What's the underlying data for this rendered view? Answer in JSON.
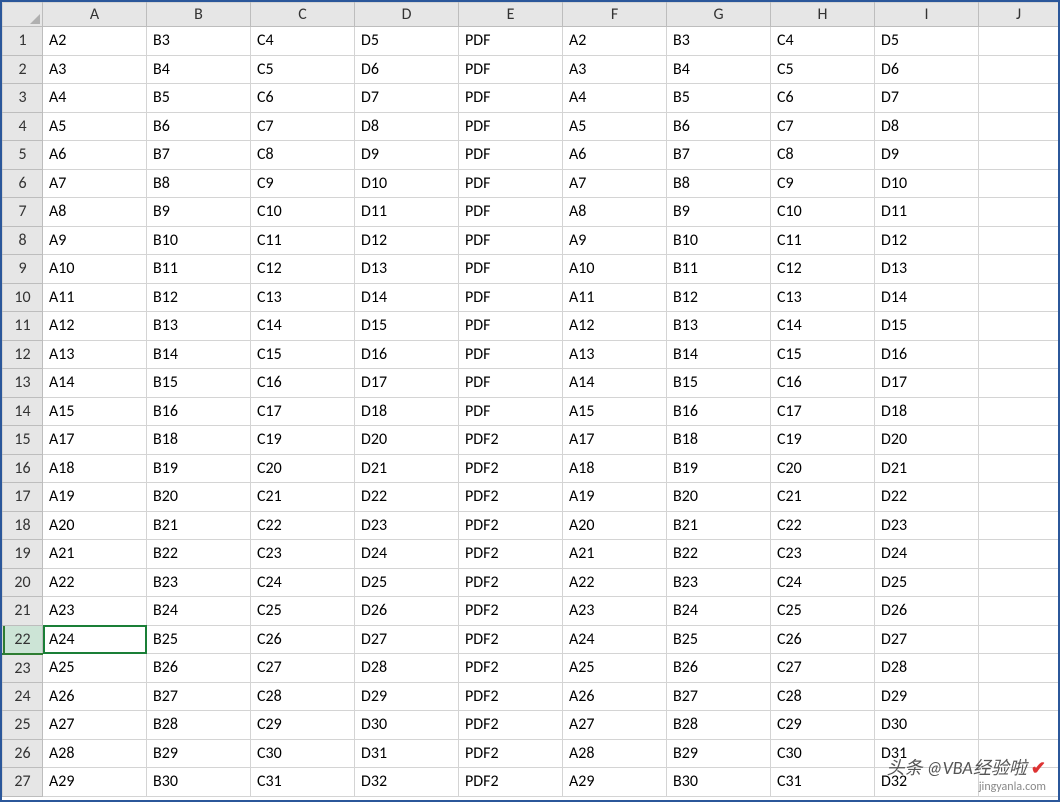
{
  "columns": [
    "A",
    "B",
    "C",
    "D",
    "E",
    "F",
    "G",
    "H",
    "I",
    "J"
  ],
  "rowNumbers": [
    1,
    2,
    3,
    4,
    5,
    6,
    7,
    8,
    9,
    10,
    11,
    12,
    13,
    14,
    15,
    16,
    17,
    18,
    19,
    20,
    21,
    22,
    23,
    24,
    25,
    26,
    27
  ],
  "selectedRow": 22,
  "selectedCol": 0,
  "rows": [
    [
      "A2",
      "B3",
      "C4",
      "D5",
      "PDF",
      "A2",
      "B3",
      "C4",
      "D5",
      ""
    ],
    [
      "A3",
      "B4",
      "C5",
      "D6",
      "PDF",
      "A3",
      "B4",
      "C5",
      "D6",
      ""
    ],
    [
      "A4",
      "B5",
      "C6",
      "D7",
      "PDF",
      "A4",
      "B5",
      "C6",
      "D7",
      ""
    ],
    [
      "A5",
      "B6",
      "C7",
      "D8",
      "PDF",
      "A5",
      "B6",
      "C7",
      "D8",
      ""
    ],
    [
      "A6",
      "B7",
      "C8",
      "D9",
      "PDF",
      "A6",
      "B7",
      "C8",
      "D9",
      ""
    ],
    [
      "A7",
      "B8",
      "C9",
      "D10",
      "PDF",
      "A7",
      "B8",
      "C9",
      "D10",
      ""
    ],
    [
      "A8",
      "B9",
      "C10",
      "D11",
      "PDF",
      "A8",
      "B9",
      "C10",
      "D11",
      ""
    ],
    [
      "A9",
      "B10",
      "C11",
      "D12",
      "PDF",
      "A9",
      "B10",
      "C11",
      "D12",
      ""
    ],
    [
      "A10",
      "B11",
      "C12",
      "D13",
      "PDF",
      "A10",
      "B11",
      "C12",
      "D13",
      ""
    ],
    [
      "A11",
      "B12",
      "C13",
      "D14",
      "PDF",
      "A11",
      "B12",
      "C13",
      "D14",
      ""
    ],
    [
      "A12",
      "B13",
      "C14",
      "D15",
      "PDF",
      "A12",
      "B13",
      "C14",
      "D15",
      ""
    ],
    [
      "A13",
      "B14",
      "C15",
      "D16",
      "PDF",
      "A13",
      "B14",
      "C15",
      "D16",
      ""
    ],
    [
      "A14",
      "B15",
      "C16",
      "D17",
      "PDF",
      "A14",
      "B15",
      "C16",
      "D17",
      ""
    ],
    [
      "A15",
      "B16",
      "C17",
      "D18",
      "PDF",
      "A15",
      "B16",
      "C17",
      "D18",
      ""
    ],
    [
      "A17",
      "B18",
      "C19",
      "D20",
      "PDF2",
      "A17",
      "B18",
      "C19",
      "D20",
      ""
    ],
    [
      "A18",
      "B19",
      "C20",
      "D21",
      "PDF2",
      "A18",
      "B19",
      "C20",
      "D21",
      ""
    ],
    [
      "A19",
      "B20",
      "C21",
      "D22",
      "PDF2",
      "A19",
      "B20",
      "C21",
      "D22",
      ""
    ],
    [
      "A20",
      "B21",
      "C22",
      "D23",
      "PDF2",
      "A20",
      "B21",
      "C22",
      "D23",
      ""
    ],
    [
      "A21",
      "B22",
      "C23",
      "D24",
      "PDF2",
      "A21",
      "B22",
      "C23",
      "D24",
      ""
    ],
    [
      "A22",
      "B23",
      "C24",
      "D25",
      "PDF2",
      "A22",
      "B23",
      "C24",
      "D25",
      ""
    ],
    [
      "A23",
      "B24",
      "C25",
      "D26",
      "PDF2",
      "A23",
      "B24",
      "C25",
      "D26",
      ""
    ],
    [
      "A24",
      "B25",
      "C26",
      "D27",
      "PDF2",
      "A24",
      "B25",
      "C26",
      "D27",
      ""
    ],
    [
      "A25",
      "B26",
      "C27",
      "D28",
      "PDF2",
      "A25",
      "B26",
      "C27",
      "D28",
      ""
    ],
    [
      "A26",
      "B27",
      "C28",
      "D29",
      "PDF2",
      "A26",
      "B27",
      "C28",
      "D29",
      ""
    ],
    [
      "A27",
      "B28",
      "C29",
      "D30",
      "PDF2",
      "A27",
      "B28",
      "C29",
      "D30",
      ""
    ],
    [
      "A28",
      "B29",
      "C30",
      "D31",
      "PDF2",
      "A28",
      "B29",
      "C30",
      "D31",
      ""
    ],
    [
      "A29",
      "B30",
      "C31",
      "D32",
      "PDF2",
      "A29",
      "B30",
      "C31",
      "D32",
      ""
    ]
  ],
  "watermark": {
    "text": "头条 @VBA经验啦",
    "mark": "✔",
    "sub": "jingyanla.com"
  }
}
